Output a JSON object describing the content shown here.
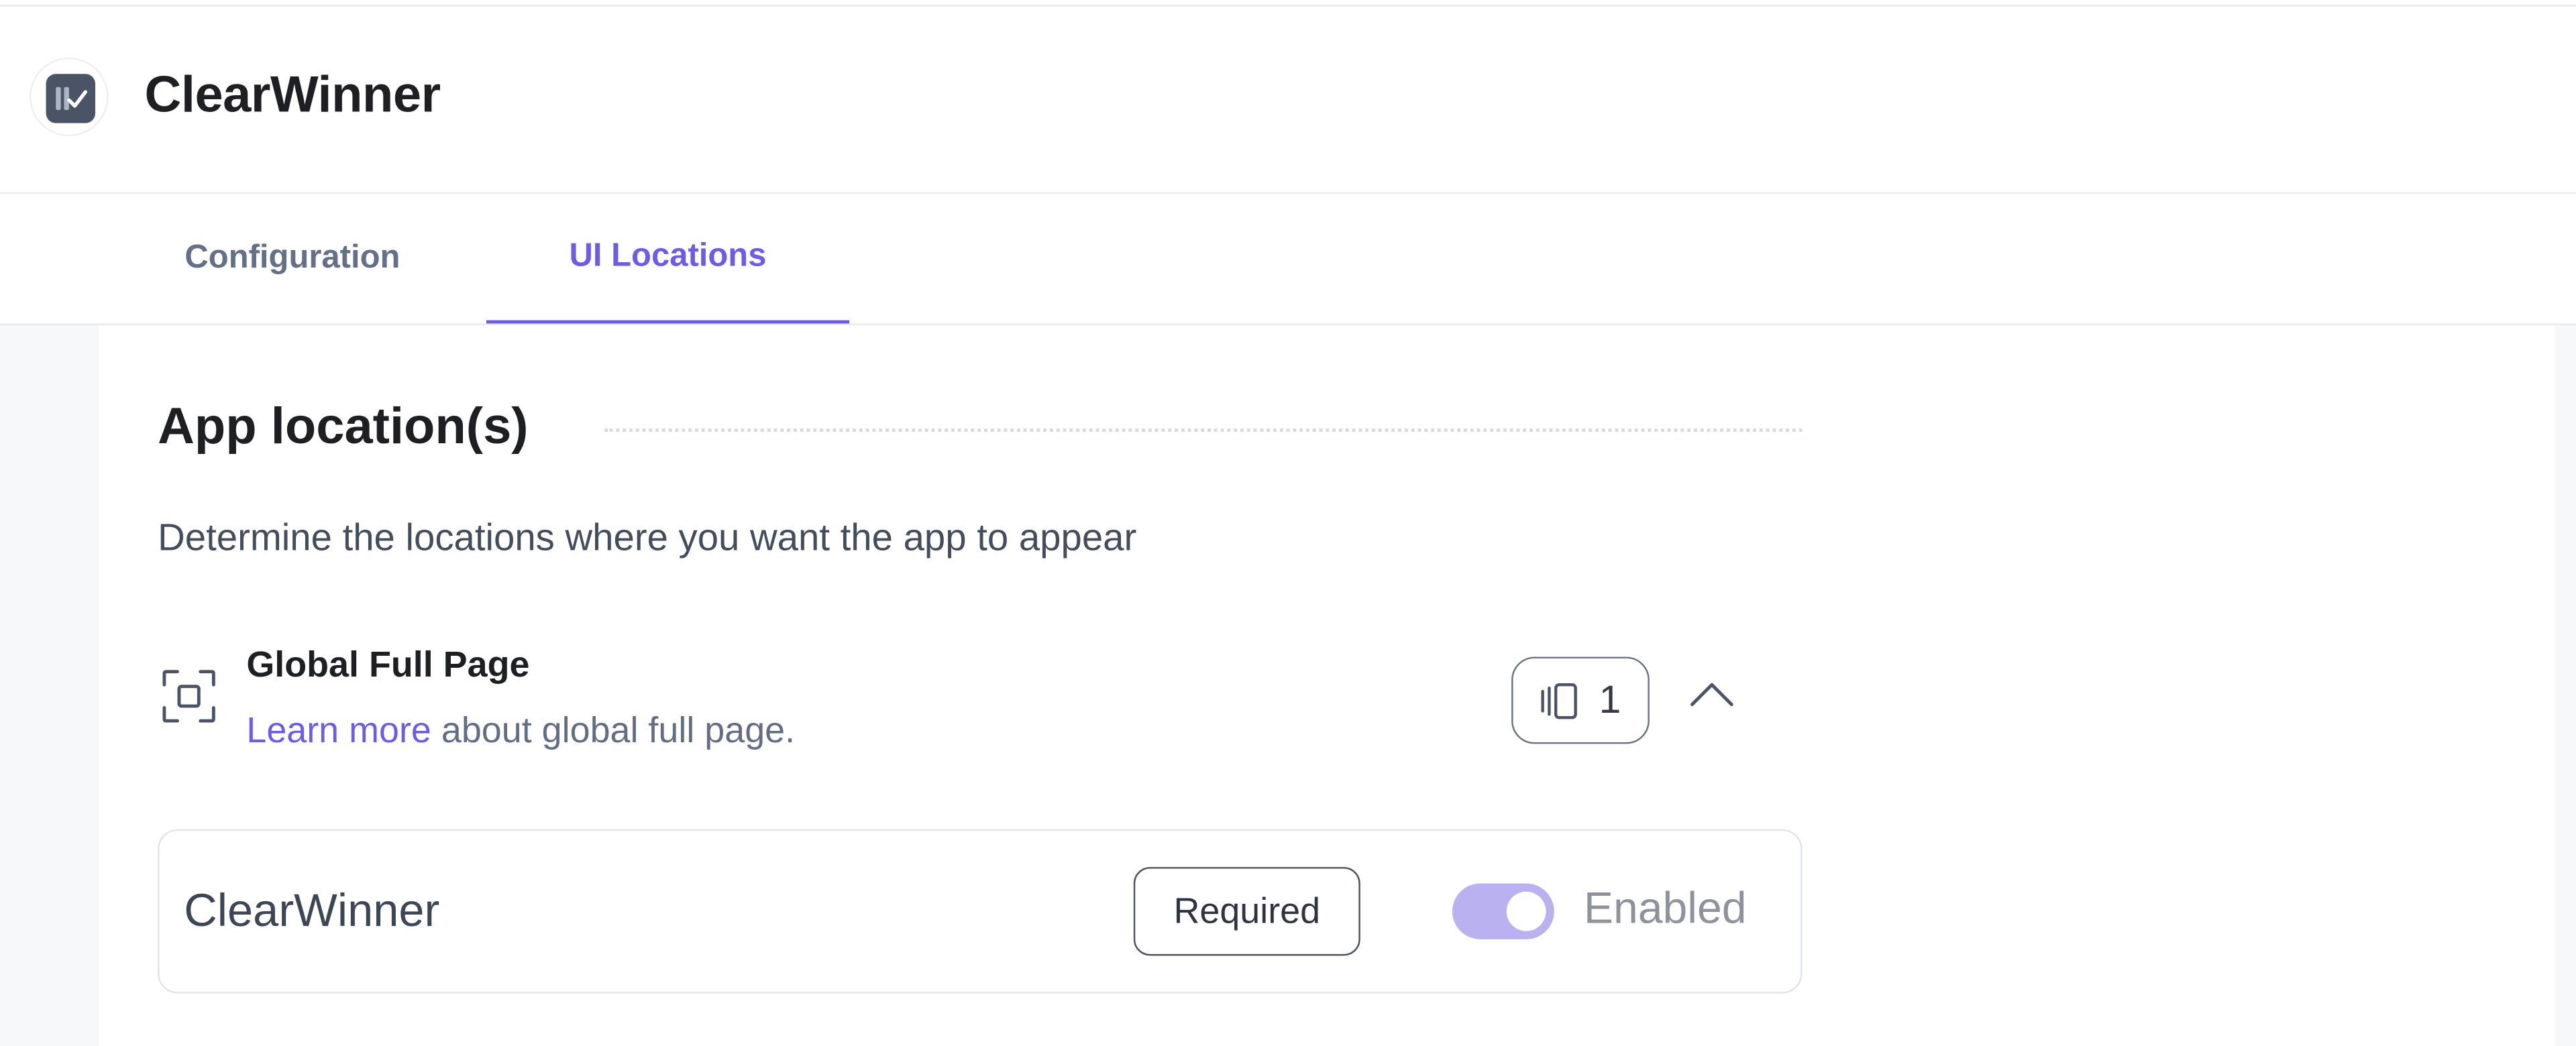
{
  "app": {
    "title": "ClearWinner",
    "logo_icon": "app-logo-icon"
  },
  "tabs": [
    {
      "label": "Configuration",
      "active": false
    },
    {
      "label": "UI Locations",
      "active": true
    }
  ],
  "section": {
    "title": "App location(s)",
    "description": "Determine the locations where you want the app to appear"
  },
  "location": {
    "icon": "full-page-icon",
    "title": "Global Full Page",
    "learn_more": "Learn more",
    "subtitle_rest": " about global full page.",
    "count": "1",
    "count_icon": "pages-icon",
    "collapse_icon": "chevron-up-icon"
  },
  "card": {
    "name": "ClearWinner",
    "badge": "Required",
    "toggle_on": true,
    "toggle_label": "Enabled"
  },
  "colors": {
    "accent": "#6c5ce7",
    "toggle_track": "#b9b1f0",
    "logo_bg": "#4a5466"
  }
}
